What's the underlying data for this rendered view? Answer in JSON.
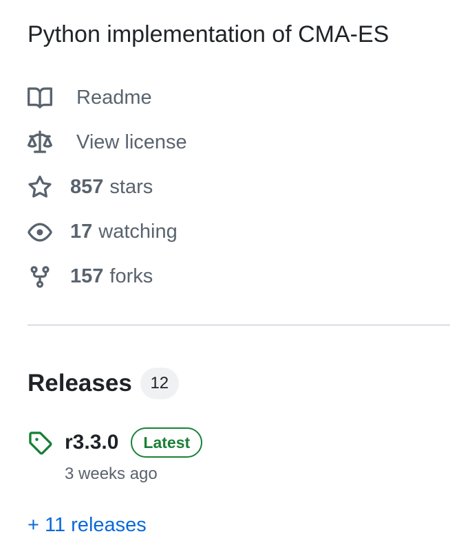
{
  "about": {
    "description": "Python implementation of CMA-ES",
    "items": [
      {
        "icon": "book-icon",
        "count": "",
        "label": "Readme"
      },
      {
        "icon": "law-scale-icon",
        "count": "",
        "label": "View license"
      },
      {
        "icon": "star-icon",
        "count": "857",
        "label": " stars"
      },
      {
        "icon": "eye-icon",
        "count": "17",
        "label": " watching"
      },
      {
        "icon": "repo-forked-icon",
        "count": "157",
        "label": " forks"
      }
    ]
  },
  "releases": {
    "title": "Releases",
    "count": "12",
    "latest": {
      "icon": "tag-icon",
      "name": "r3.3.0",
      "badge": "Latest",
      "date": "3 weeks ago"
    },
    "more_link": "+ 11 releases"
  },
  "colors": {
    "text_primary": "#1f2328",
    "text_muted": "#59636e",
    "accent_green": "#1a7f37",
    "link_blue": "#0969da",
    "divider": "#d8dee4",
    "counter_bg": "#eff1f3"
  }
}
